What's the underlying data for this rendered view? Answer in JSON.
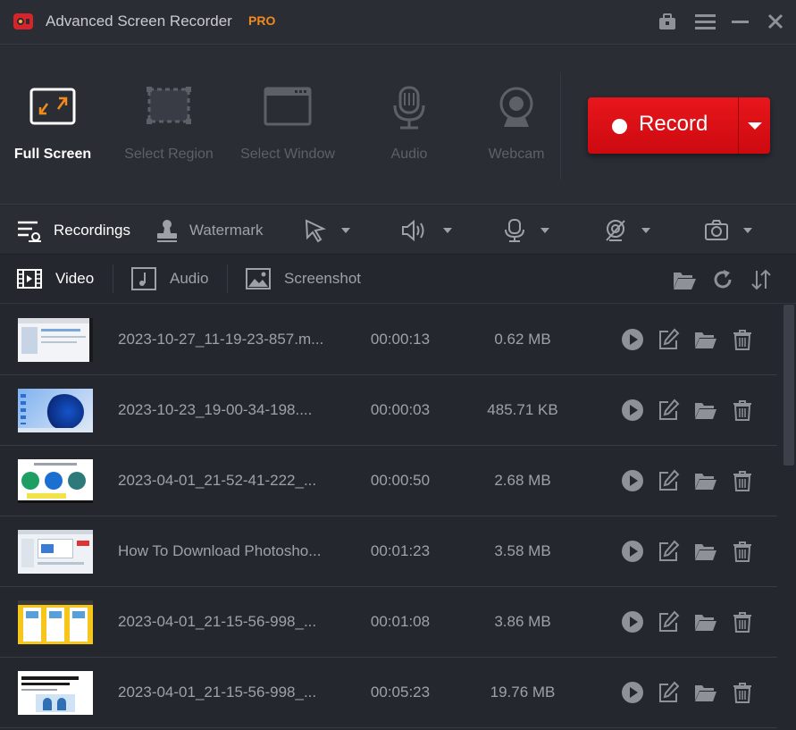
{
  "app": {
    "title": "Advanced Screen Recorder",
    "badge": "PRO",
    "badge_color": "#f08a1c",
    "window_controls": [
      "toolbox-icon",
      "menu-icon",
      "minimize-icon",
      "close-icon"
    ]
  },
  "modes": [
    {
      "label": "Full Screen",
      "icon": "full-screen-icon",
      "active": true
    },
    {
      "label": "Select Region",
      "icon": "select-region-icon",
      "active": false
    },
    {
      "label": "Select Window",
      "icon": "select-window-icon",
      "active": false
    },
    {
      "label": "Audio",
      "icon": "microphone-icon",
      "active": false
    },
    {
      "label": "Webcam",
      "icon": "webcam-icon",
      "active": false
    }
  ],
  "record_button": {
    "label": "Record",
    "color": "#e31217"
  },
  "options_bar": {
    "recordings_label": "Recordings",
    "watermark_label": "Watermark",
    "dropdowns": [
      "cursor-icon",
      "speaker-icon",
      "microphone-icon",
      "webcam-off-icon",
      "camera-icon"
    ]
  },
  "tabs": [
    {
      "label": "Video",
      "icon": "film-icon",
      "active": true
    },
    {
      "label": "Audio",
      "icon": "music-note-icon",
      "active": false
    },
    {
      "label": "Screenshot",
      "icon": "image-icon",
      "active": false
    }
  ],
  "tab_tools": [
    "folder-open-icon",
    "refresh-icon",
    "sort-icon"
  ],
  "recordings": [
    {
      "name": "2023-10-27_11-19-23-857.m...",
      "duration": "00:00:13",
      "size": "0.62 MB",
      "thumb": "white"
    },
    {
      "name": "2023-10-23_19-00-34-198....",
      "duration": "00:00:03",
      "size": "485.71 KB",
      "thumb": "win11"
    },
    {
      "name": "2023-04-01_21-52-41-222_...",
      "duration": "00:00:50",
      "size": "2.68 MB",
      "thumb": "circles"
    },
    {
      "name": "How To Download Photosho...",
      "duration": "00:01:23",
      "size": "3.58 MB",
      "thumb": "browser"
    },
    {
      "name": "2023-04-01_21-15-56-998_...",
      "duration": "00:01:08",
      "size": "3.86 MB",
      "thumb": "yellow"
    },
    {
      "name": "2023-04-01_21-15-56-998_...",
      "duration": "00:05:23",
      "size": "19.76 MB",
      "thumb": "article"
    }
  ],
  "row_actions": [
    "play-icon",
    "edit-icon",
    "folder-icon",
    "trash-icon"
  ]
}
